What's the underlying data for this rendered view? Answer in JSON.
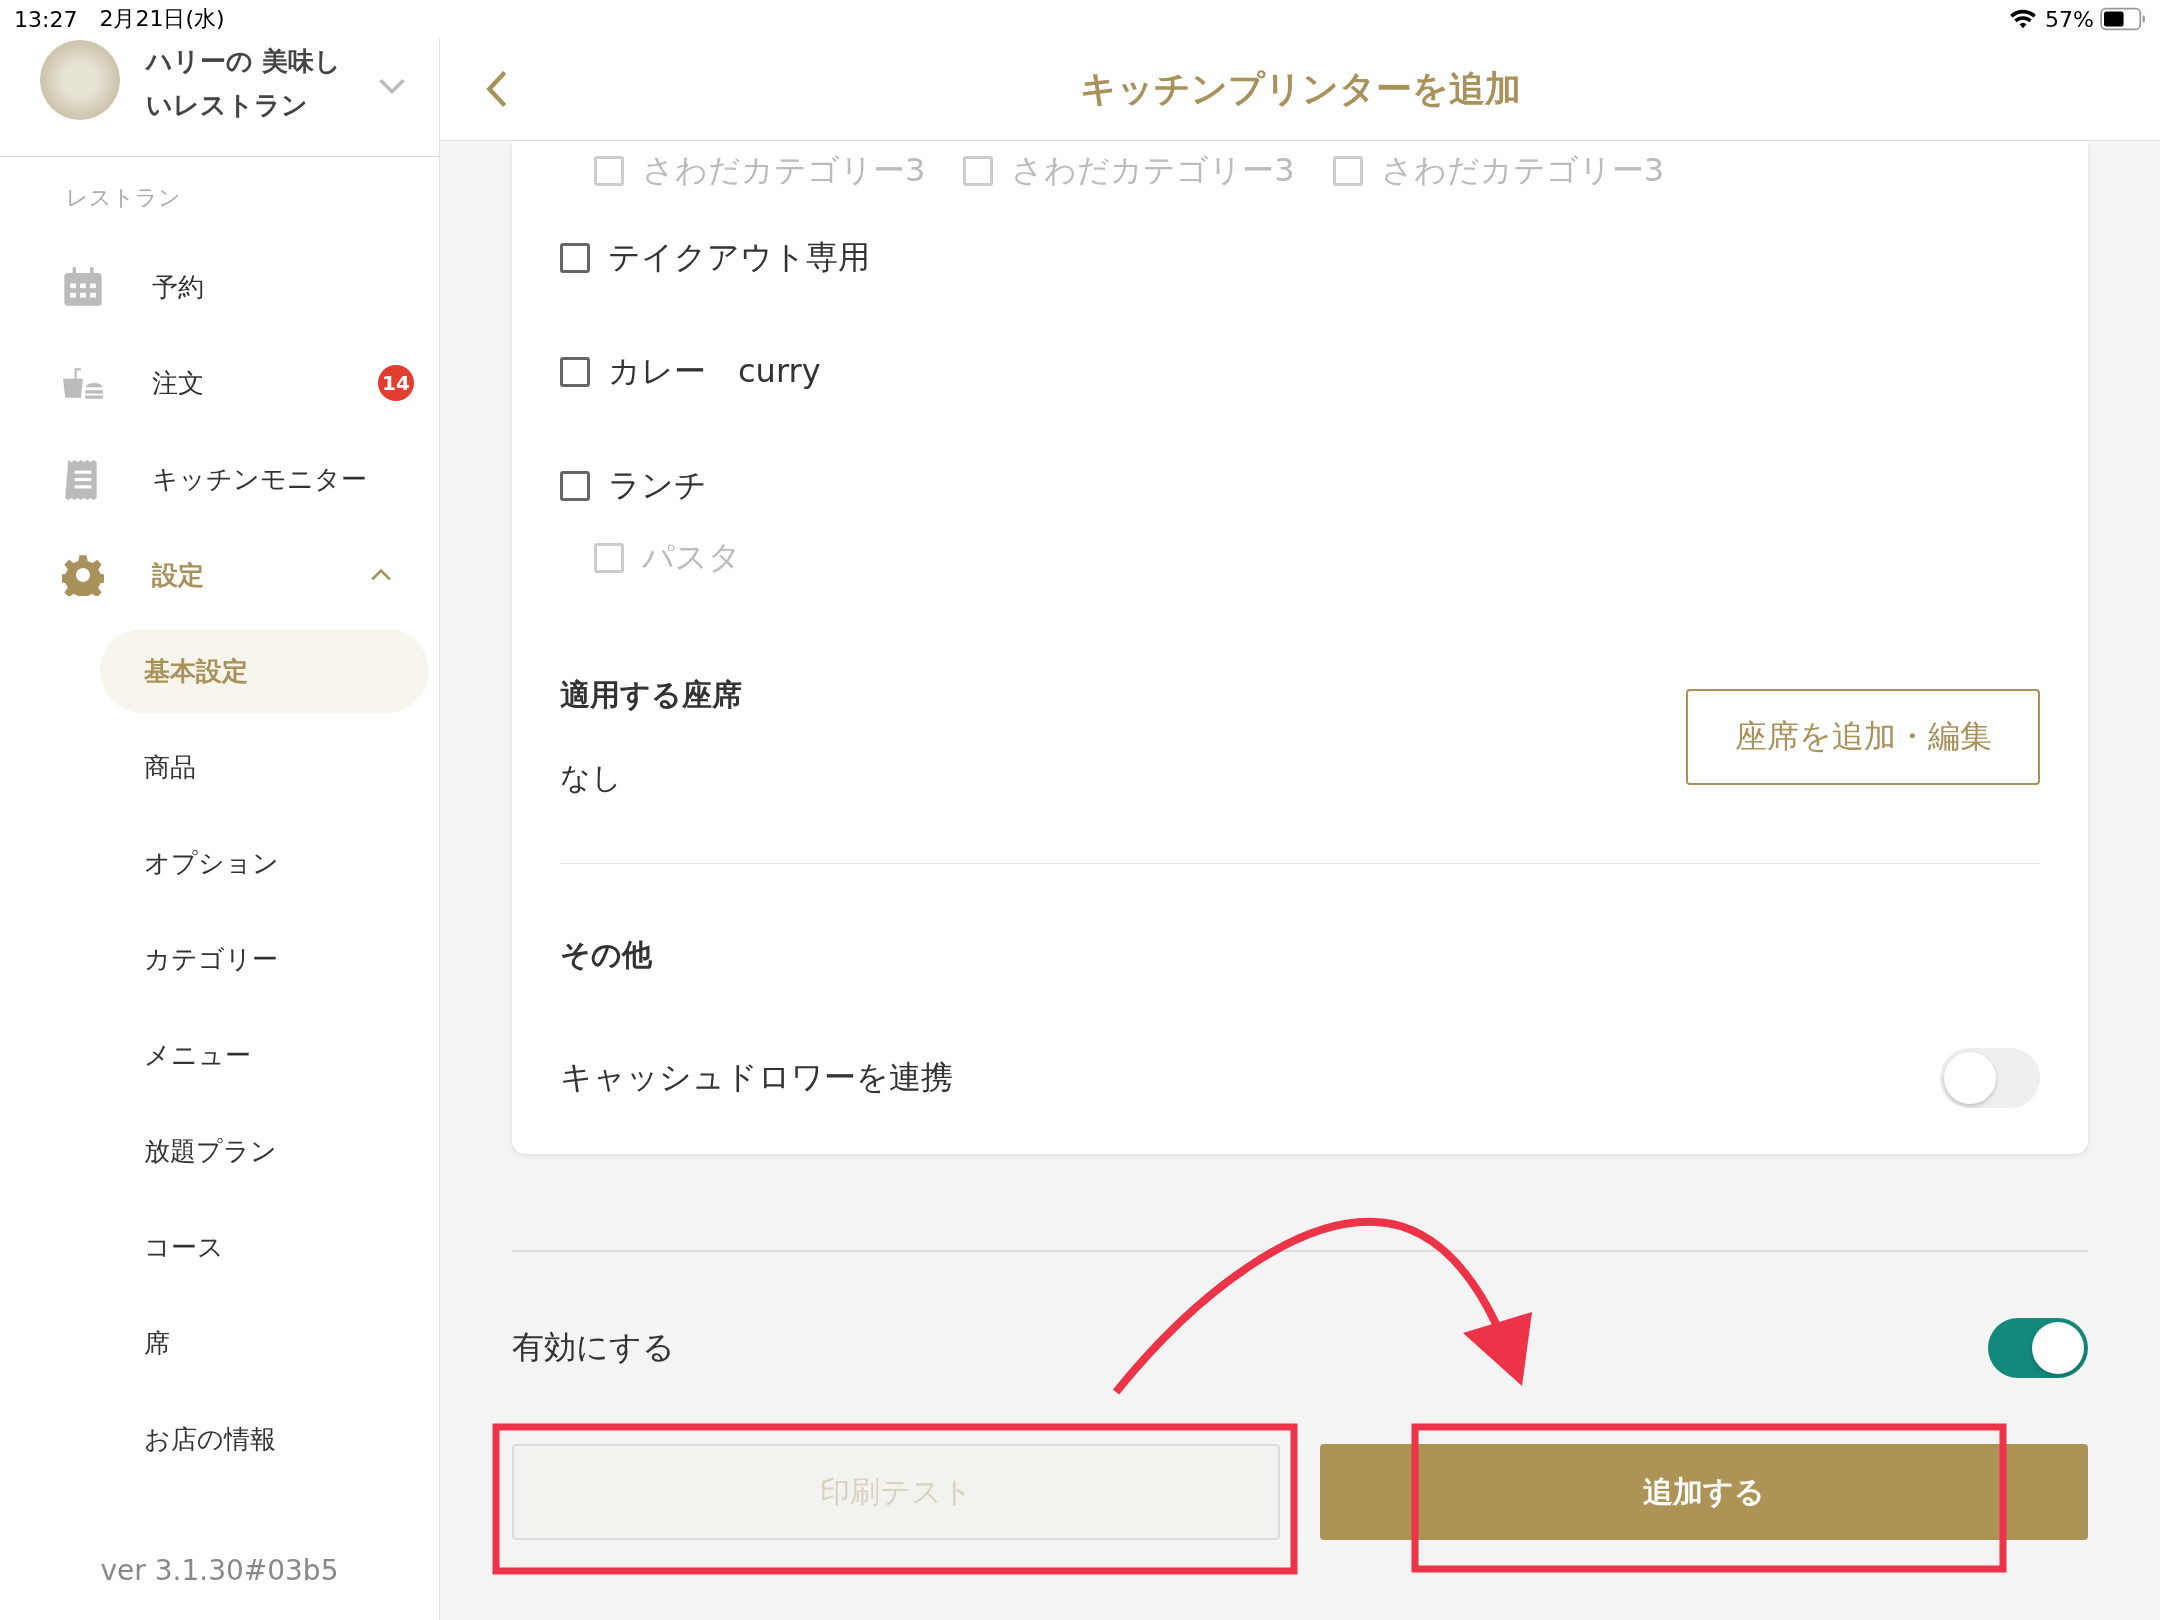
{
  "status_bar": {
    "time": "13:27",
    "date": "2月21日(水)",
    "battery": "57%"
  },
  "restaurant": {
    "name": "ハリーの 美味しいレストラン"
  },
  "sidebar": {
    "section": "レストラン",
    "items": [
      {
        "label": "予約",
        "selected": false
      },
      {
        "label": "注文",
        "badge": "14",
        "selected": false
      },
      {
        "label": "キッチンモニター",
        "selected": false
      },
      {
        "label": "設定",
        "selected": true,
        "expanded": true,
        "children": [
          {
            "label": "基本設定",
            "selected": true
          },
          {
            "label": "商品",
            "selected": false
          },
          {
            "label": "オプション",
            "selected": false
          },
          {
            "label": "カテゴリー",
            "selected": false
          },
          {
            "label": "メニュー",
            "selected": false
          },
          {
            "label": "放題プラン",
            "selected": false
          },
          {
            "label": "コース",
            "selected": false
          },
          {
            "label": "席",
            "selected": false
          },
          {
            "label": "お店の情報",
            "selected": false
          }
        ]
      }
    ],
    "version": "ver 3.1.30#03b5"
  },
  "header": {
    "title": "キッチンプリンターを追加"
  },
  "categories": [
    {
      "children": [
        {
          "label": "さわだカテゴリー3",
          "checked": false
        },
        {
          "label": "さわだカテゴリー3",
          "checked": false
        },
        {
          "label": "さわだカテゴリー3",
          "checked": false
        }
      ]
    },
    {
      "label": "テイクアウト専用",
      "checked": false
    },
    {
      "label": "カレー　curry",
      "checked": false
    },
    {
      "label": "ランチ",
      "checked": false,
      "children": [
        {
          "label": "パスタ",
          "checked": false
        }
      ]
    }
  ],
  "seats": {
    "heading": "適用する座席",
    "value": "なし",
    "button": "座席を追加・編集"
  },
  "other": {
    "heading": "その他",
    "settings": [
      {
        "label": "キャッシュドロワーを連携",
        "on": false
      }
    ]
  },
  "enable": {
    "label": "有効にする",
    "on": true
  },
  "buttons": [
    {
      "label": "印刷テスト",
      "kind": "secondary",
      "disabled": true
    },
    {
      "label": "追加する",
      "kind": "primary",
      "disabled": false
    }
  ]
}
